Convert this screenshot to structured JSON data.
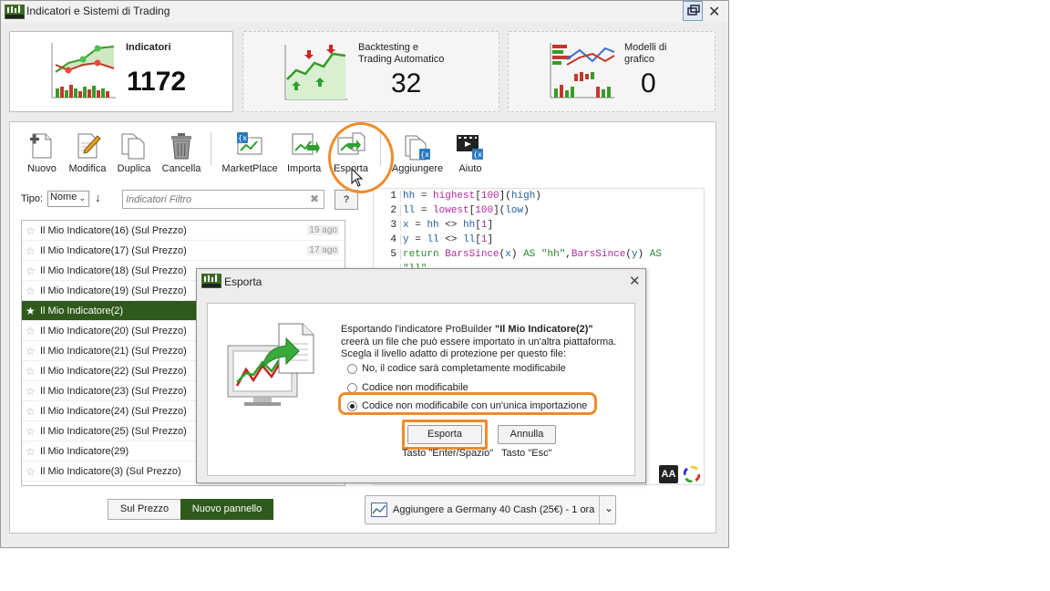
{
  "window": {
    "title": "Indicatori e Sistemi di Trading"
  },
  "cards": [
    {
      "title": "Indicatori",
      "count": "1172"
    },
    {
      "title_line1": "Backtesting e",
      "title_line2": "Trading Automatico",
      "count": "32"
    },
    {
      "title_line1": "Modelli di",
      "title_line2": "grafico",
      "count": "0"
    }
  ],
  "toolbar": {
    "nuovo": "Nuovo",
    "modifica": "Modifica",
    "duplica": "Duplica",
    "cancella": "Cancella",
    "marketplace": "MarketPlace",
    "importa": "Importa",
    "esporta": "Esporta",
    "aggiungere": "Aggiungere",
    "aiuto": "Aiuto"
  },
  "filter": {
    "tipo_label": "Tipo:",
    "tipo_value": "Nome",
    "placeholder": "Indicatori Filtro"
  },
  "list": [
    {
      "name": "Il Mio Indicatore(16) (Sul Prezzo)",
      "date": "19 ago"
    },
    {
      "name": "Il Mio Indicatore(17) (Sul Prezzo)",
      "date": "17 ago"
    },
    {
      "name": "Il Mio Indicatore(18) (Sul Prezzo)",
      "date": ""
    },
    {
      "name": "Il Mio Indicatore(19) (Sul Prezzo)",
      "date": ""
    },
    {
      "name": "Il Mio Indicatore(2)",
      "date": "",
      "selected": true
    },
    {
      "name": "Il Mio Indicatore(20) (Sul Prezzo)",
      "date": ""
    },
    {
      "name": "Il Mio Indicatore(21) (Sul Prezzo)",
      "date": ""
    },
    {
      "name": "Il Mio Indicatore(22) (Sul Prezzo)",
      "date": ""
    },
    {
      "name": "Il Mio Indicatore(23) (Sul Prezzo)",
      "date": ""
    },
    {
      "name": "Il Mio Indicatore(24) (Sul Prezzo)",
      "date": ""
    },
    {
      "name": "Il Mio Indicatore(25) (Sul Prezzo)",
      "date": ""
    },
    {
      "name": "Il Mio Indicatore(29)",
      "date": ""
    },
    {
      "name": "Il Mio Indicatore(3) (Sul Prezzo)",
      "date": ""
    }
  ],
  "code": {
    "line_numbers": [
      "1",
      "2",
      "3",
      "4",
      "5"
    ],
    "lines": [
      "hh = highest[100](high)",
      "ll = lowest[100](low)",
      "x = hh <> hh[1]",
      "y = ll <> ll[1]",
      "return BarsSince(x) AS \"hh\",BarsSince(y) AS",
      "\"ll\""
    ]
  },
  "bottom": {
    "sul_prezzo": "Sul Prezzo",
    "nuovo_pannello": "Nuovo pannello",
    "add_to_chart": "Aggiungere a Germany 40 Cash (25€) - 1 ora"
  },
  "dialog": {
    "title": "Esporta",
    "intro_prefix": "Esportando l'indicatore ProBuilder ",
    "intro_name": "\"Il Mio Indicatore(2)\"",
    "line2": "creerà un file che può essere importato in un'altra piattaforma.",
    "line3": "Scegla il livello adatto di protezione per questo file:",
    "options": [
      "No, il codice sarà completamente modificabile",
      "Codice non modificabile",
      "Codice non modificabile con un'unica importazione"
    ],
    "selected_option": 2,
    "export_button": "Esporta",
    "cancel_button": "Annulla",
    "export_hint": "Tasto \"Enter/Spazio\"",
    "cancel_hint": "Tasto \"Esc\""
  },
  "editor_tools": {
    "font_button": "AA"
  },
  "colors": {
    "accent_green": "#2f5a1b",
    "highlight_orange": "#f08b2a",
    "code_keyword": "#2b8a2b",
    "code_function": "#b02a9a"
  }
}
